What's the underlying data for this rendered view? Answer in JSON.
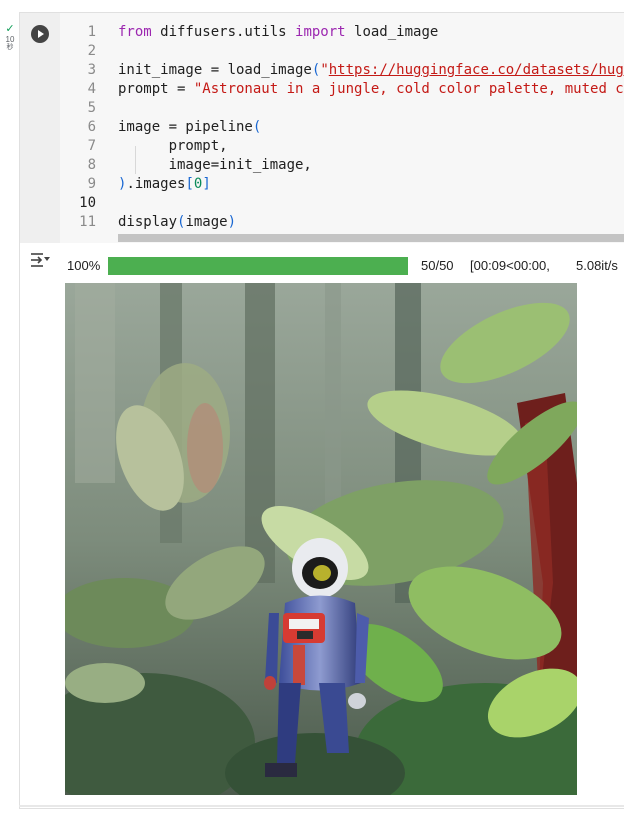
{
  "cell_status": {
    "time_value": "10",
    "time_unit": "秒"
  },
  "code_lines": [
    {
      "num": "1",
      "tokens": [
        {
          "t": "from",
          "c": "kw"
        },
        {
          "t": " diffusers.utils ",
          "c": ""
        },
        {
          "t": "import",
          "c": "kw"
        },
        {
          "t": " load_image",
          "c": ""
        }
      ]
    },
    {
      "num": "2",
      "tokens": []
    },
    {
      "num": "3",
      "tokens": [
        {
          "t": "init_image = load_image",
          "c": ""
        },
        {
          "t": "(",
          "c": "br"
        },
        {
          "t": "\"",
          "c": "str"
        },
        {
          "t": "https://huggingface.co/datasets/hugg",
          "c": "url"
        }
      ]
    },
    {
      "num": "4",
      "tokens": [
        {
          "t": "prompt = ",
          "c": ""
        },
        {
          "t": "\"Astronaut in a jungle, cold color palette, muted co",
          "c": "str"
        }
      ]
    },
    {
      "num": "5",
      "tokens": []
    },
    {
      "num": "6",
      "tokens": [
        {
          "t": "image = pipeline",
          "c": ""
        },
        {
          "t": "(",
          "c": "br"
        }
      ]
    },
    {
      "num": "7",
      "tokens": [
        {
          "t": "      prompt,",
          "c": ""
        }
      ]
    },
    {
      "num": "8",
      "tokens": [
        {
          "t": "      image=init_image,",
          "c": ""
        }
      ]
    },
    {
      "num": "9",
      "tokens": [
        {
          "t": ")",
          "c": "br"
        },
        {
          "t": ".images",
          "c": ""
        },
        {
          "t": "[",
          "c": "br"
        },
        {
          "t": "0",
          "c": "num"
        },
        {
          "t": "]",
          "c": "br"
        }
      ]
    },
    {
      "num": "10",
      "tokens": [],
      "bold": true
    },
    {
      "num": "11",
      "tokens": [
        {
          "t": "display",
          "c": ""
        },
        {
          "t": "(",
          "c": "br"
        },
        {
          "t": "image",
          "c": ""
        },
        {
          "t": ")",
          "c": "br"
        }
      ]
    }
  ],
  "progress": {
    "percent_label": "100%",
    "fraction": 1.0,
    "count": "50/50",
    "elapsed": "[00:09<00:00,",
    "rate": "5.08it/s"
  },
  "colors": {
    "progress_fill": "#4caf50",
    "run_button": "#444444"
  },
  "icons": {
    "run": "play-icon",
    "output_toggle": "output-toggle-icon",
    "status": "check-icon"
  }
}
